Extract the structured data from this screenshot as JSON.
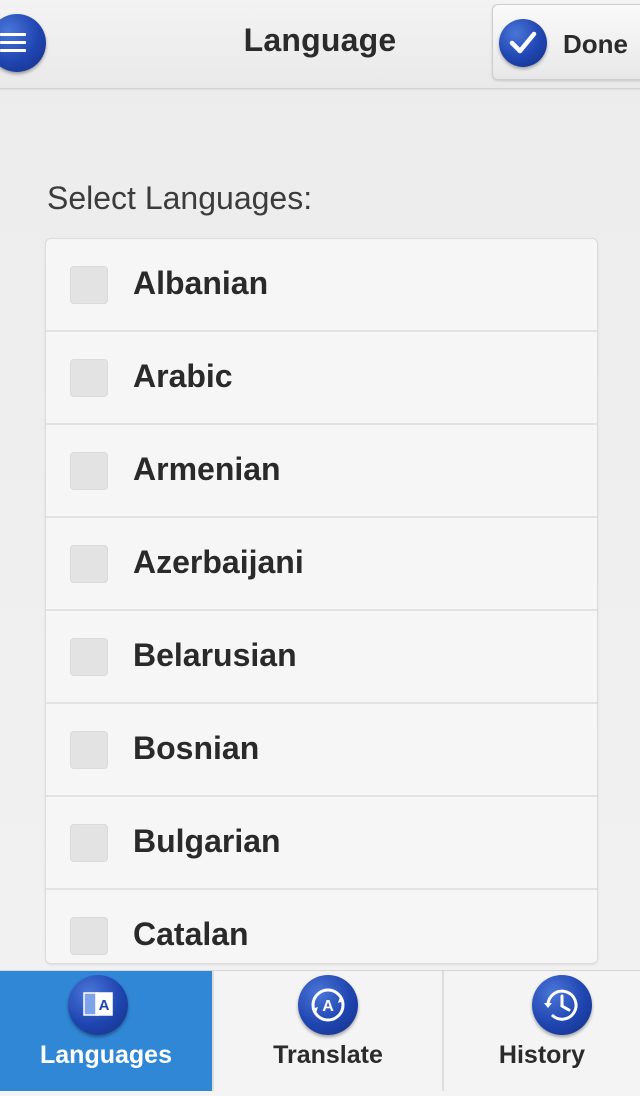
{
  "header": {
    "title": "Language",
    "menu_icon": "menu-icon",
    "done_label": "Done",
    "done_icon": "checkmark-icon"
  },
  "content": {
    "section_label": "Select Languages:",
    "languages": [
      {
        "label": "Albanian",
        "checked": false
      },
      {
        "label": "Arabic",
        "checked": false
      },
      {
        "label": "Armenian",
        "checked": false
      },
      {
        "label": "Azerbaijani",
        "checked": false
      },
      {
        "label": "Belarusian",
        "checked": false
      },
      {
        "label": "Bosnian",
        "checked": false
      },
      {
        "label": "Bulgarian",
        "checked": false
      },
      {
        "label": "Catalan",
        "checked": false
      }
    ]
  },
  "tabbar": {
    "tabs": [
      {
        "label": "Languages",
        "icon": "languages-icon",
        "active": true
      },
      {
        "label": "Translate",
        "icon": "translate-icon",
        "active": false
      },
      {
        "label": "History",
        "icon": "history-icon",
        "active": false
      }
    ]
  },
  "colors": {
    "accent_blue": "#1f45b0",
    "active_tab": "#3087d6",
    "background": "#ececec"
  }
}
